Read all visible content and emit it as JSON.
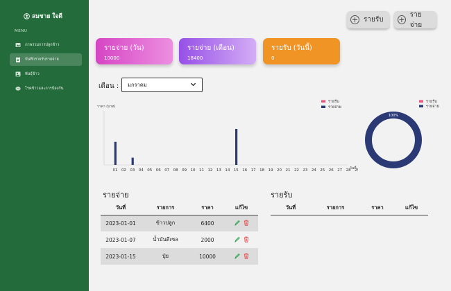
{
  "sidebar": {
    "brand": "สมชาย ใจดี",
    "menu_title": "MENU",
    "items": [
      {
        "label": "ภาพรวมการปลูกข้าว",
        "icon": "image-icon"
      },
      {
        "label": "บันทึกรายรับรายจ่าย",
        "icon": "clipboard-icon"
      },
      {
        "label": "พันธุ์ข้าว",
        "icon": "photo-icon"
      },
      {
        "label": "โรคข้าวและการป้องกัน",
        "icon": "chat-icon"
      }
    ]
  },
  "actions": {
    "income_label": "รายรับ",
    "expense_label": "รายจ่าย"
  },
  "cards": {
    "expense_day": {
      "title": "รายจ่าย (วัน)",
      "value": "10000",
      "color": "#d949c8"
    },
    "expense_month": {
      "title": "รายจ่าย (เดือน)",
      "value": "18400",
      "color": "#9a55e8"
    },
    "income_today": {
      "title": "รายรับ (วันนี้)",
      "value": "0",
      "color": "#ef9425"
    }
  },
  "filter": {
    "month_label": "เดือน :",
    "month_value": "มกราคม"
  },
  "chart_data": [
    {
      "type": "bar",
      "ylabel": "ราคา (บาท)",
      "categories": [
        "01",
        "02",
        "03",
        "04",
        "05",
        "06",
        "07",
        "08",
        "09",
        "10",
        "11",
        "12",
        "13",
        "14",
        "15",
        "16",
        "17",
        "18",
        "19",
        "20",
        "21",
        "22",
        "23",
        "24",
        "25",
        "26",
        "27",
        "28",
        "29",
        "30",
        "31"
      ],
      "series": [
        {
          "name": "รายรับ",
          "color": "#e8567e",
          "values": [
            0,
            0,
            0,
            0,
            0,
            0,
            0,
            0,
            0,
            0,
            0,
            0,
            0,
            0,
            0,
            0,
            0,
            0,
            0,
            0,
            0,
            0,
            0,
            0,
            0,
            0,
            0,
            0,
            0,
            0,
            0
          ]
        },
        {
          "name": "รายจ่าย",
          "color": "#2b3a74",
          "values": [
            6400,
            0,
            2000,
            0,
            0,
            0,
            0,
            0,
            0,
            0,
            0,
            0,
            0,
            0,
            10000,
            0,
            0,
            0,
            0,
            0,
            0,
            0,
            0,
            0,
            0,
            0,
            0,
            0,
            0,
            0,
            0
          ]
        }
      ],
      "ylim": [
        0,
        15000
      ],
      "legend": "top-right"
    },
    {
      "type": "pie",
      "donut": true,
      "categories": [
        "รายรับ",
        "รายจ่าย"
      ],
      "values": [
        0,
        100
      ],
      "colors": [
        "#e8567e",
        "#2b3a74"
      ],
      "label": "100%",
      "legend": "top-right"
    }
  ],
  "chart_axis_suffix": "วันที่",
  "expense_table": {
    "title": "รายจ่าย",
    "headers": [
      "วันที่",
      "รายการ",
      "ราคา",
      "แก้ไข"
    ],
    "rows": [
      {
        "date": "2023-01-01",
        "item": "ข้าวปลูก",
        "price": "6400"
      },
      {
        "date": "2023-01-07",
        "item": "น้ำมันดีเซล",
        "price": "2000"
      },
      {
        "date": "2023-01-15",
        "item": "ปุ๋ย",
        "price": "10000"
      }
    ]
  },
  "income_table": {
    "title": "รายรับ",
    "headers": [
      "วันที่",
      "รายการ",
      "ราคา",
      "แก้ไข"
    ],
    "rows": []
  }
}
